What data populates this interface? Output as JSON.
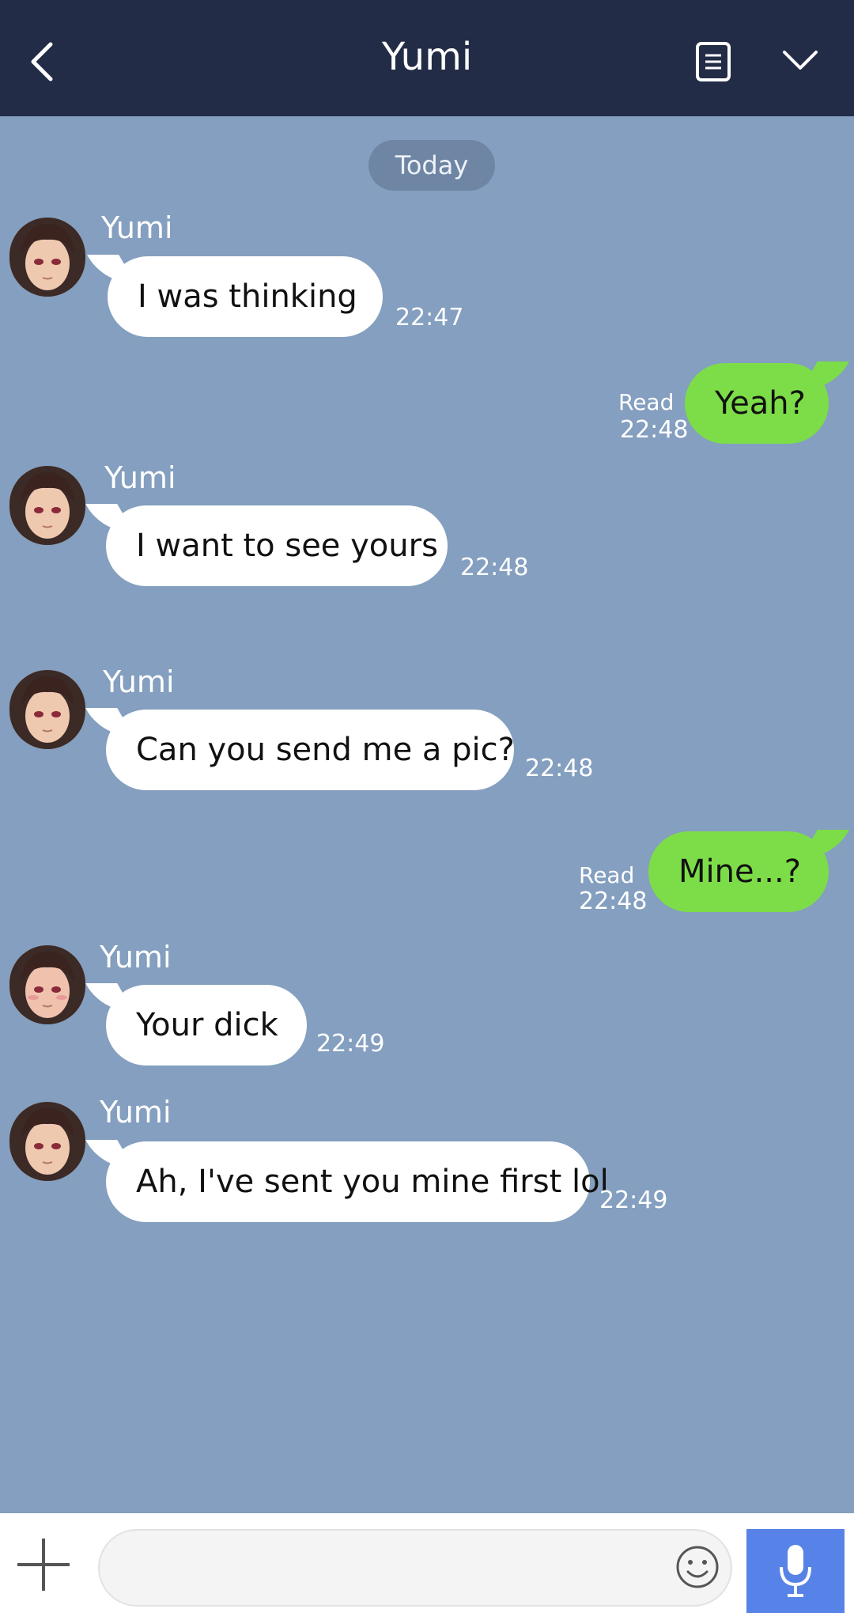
{
  "header": {
    "title": "Yumi",
    "back_icon": "chevron-left-icon",
    "notes_icon": "note-icon",
    "collapse_icon": "chevron-down-icon"
  },
  "chat": {
    "date_label": "Today",
    "messages": [
      {
        "direction": "in",
        "sender": "Yumi",
        "text": "I was thinking",
        "time": "22:47"
      },
      {
        "direction": "out",
        "text": "Yeah?",
        "status": "Read",
        "time": "22:48"
      },
      {
        "direction": "in",
        "sender": "Yumi",
        "text": "I want to see yours",
        "time": "22:48"
      },
      {
        "direction": "in",
        "sender": "Yumi",
        "text": "Can you send me a pic?",
        "time": "22:48"
      },
      {
        "direction": "out",
        "text": "Mine...?",
        "status": "Read",
        "time": "22:48"
      },
      {
        "direction": "in",
        "sender": "Yumi",
        "text": "Your dick",
        "time": "22:49"
      },
      {
        "direction": "in",
        "sender": "Yumi",
        "text": "Ah, I've sent you mine first lol",
        "time": "22:49"
      }
    ]
  },
  "composer": {
    "input_value": "",
    "add_icon": "plus-icon",
    "emoji_icon": "smiley-icon",
    "voice_icon": "microphone-icon"
  },
  "colors": {
    "header_bg": "#232c46",
    "chat_bg": "#849fbf",
    "incoming_bubble": "#ffffff",
    "outgoing_bubble": "#7ddd48",
    "mic_button": "#5783e8"
  }
}
